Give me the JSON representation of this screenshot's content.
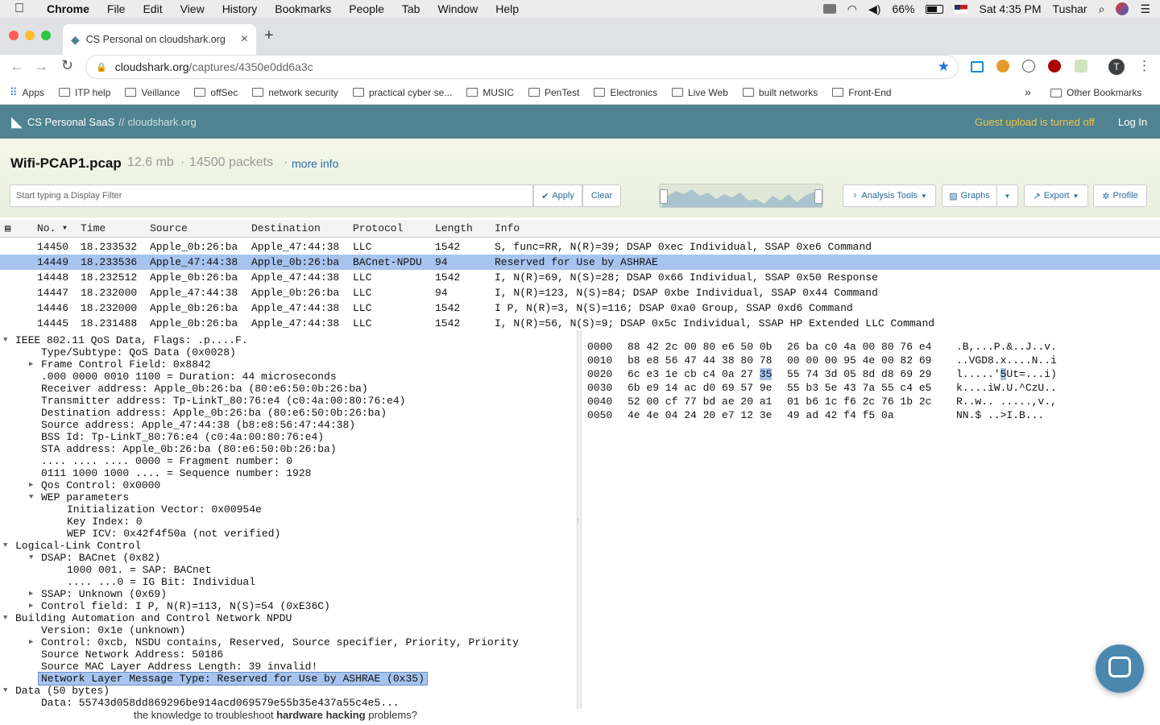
{
  "menubar": {
    "app": "Chrome",
    "items": [
      "File",
      "Edit",
      "View",
      "History",
      "Bookmarks",
      "People",
      "Tab",
      "Window",
      "Help"
    ],
    "battery": "66%",
    "clock": "Sat 4:35 PM",
    "user": "Tushar"
  },
  "tab": {
    "title": "CS Personal on cloudshark.org",
    "close": "×",
    "new": "+"
  },
  "omnibox": {
    "host": "cloudshark.org",
    "path": "/captures/4350e0dd6a3c"
  },
  "bookmarks": [
    "Apps",
    "ITP help",
    "Veillance",
    "offSec",
    "network security",
    "practical cyber se...",
    "MUSIC",
    "PenTest",
    "Electronics",
    "Live Web",
    "built networks",
    "Front-End"
  ],
  "bookmarks_more": "»",
  "bookmarks_other": "Other Bookmarks",
  "header": {
    "brand": "CS Personal SaaS",
    "sep": "//",
    "domain": "cloudshark.org",
    "notice": "Guest upload is turned off",
    "login": "Log In"
  },
  "file": {
    "name": "Wifi-PCAP1.pcap",
    "size": "12.6 mb",
    "dot": "·",
    "packets": "14500 packets",
    "more": "more info"
  },
  "filter": {
    "placeholder": "Start typing a Display Filter",
    "apply": "Apply",
    "clear": "Clear"
  },
  "tools": {
    "analysis": "Analysis Tools",
    "graphs": "Graphs",
    "export": "Export",
    "profile": "Profile"
  },
  "columns": [
    "No.",
    "Time",
    "Source",
    "Destination",
    "Protocol",
    "Length",
    "Info"
  ],
  "packets": [
    {
      "no": "14450",
      "time": "18.233532",
      "src": "Apple_0b:26:ba",
      "dst": "Apple_47:44:38",
      "proto": "LLC",
      "len": "1542",
      "info": "S, func=RR, N(R)=39; DSAP 0xec Individual, SSAP 0xe6 Command"
    },
    {
      "no": "14449",
      "time": "18.233536",
      "src": "Apple_47:44:38",
      "dst": "Apple_0b:26:ba",
      "proto": "BACnet-NPDU",
      "len": "94",
      "info": "Reserved for Use by ASHRAE"
    },
    {
      "no": "14448",
      "time": "18.232512",
      "src": "Apple_0b:26:ba",
      "dst": "Apple_47:44:38",
      "proto": "LLC",
      "len": "1542",
      "info": "I, N(R)=69, N(S)=28; DSAP 0x66 Individual, SSAP 0x50 Response"
    },
    {
      "no": "14447",
      "time": "18.232000",
      "src": "Apple_47:44:38",
      "dst": "Apple_0b:26:ba",
      "proto": "LLC",
      "len": "94",
      "info": "I, N(R)=123, N(S)=84; DSAP 0xbe Individual, SSAP 0x44 Command"
    },
    {
      "no": "14446",
      "time": "18.232000",
      "src": "Apple_0b:26:ba",
      "dst": "Apple_47:44:38",
      "proto": "LLC",
      "len": "1542",
      "info": "I P, N(R)=3, N(S)=116; DSAP 0xa0 Group, SSAP 0xd6 Command"
    },
    {
      "no": "14445",
      "time": "18.231488",
      "src": "Apple_0b:26:ba",
      "dst": "Apple_47:44:38",
      "proto": "LLC",
      "len": "1542",
      "info": "I, N(R)=56, N(S)=9; DSAP 0x5c Individual, SSAP HP Extended LLC Command"
    }
  ],
  "details": [
    {
      "t": "IEEE 802.11 QoS Data, Flags: .p....F.",
      "lvl": 0,
      "tw": "open"
    },
    {
      "t": "Type/Subtype: QoS Data (0x0028)",
      "lvl": 1,
      "tw": ""
    },
    {
      "t": "Frame Control Field: 0x8842",
      "lvl": 1,
      "tw": "closed"
    },
    {
      "t": ".000 0000 0010 1100 = Duration: 44 microseconds",
      "lvl": 1,
      "tw": ""
    },
    {
      "t": "Receiver address: Apple_0b:26:ba (80:e6:50:0b:26:ba)",
      "lvl": 1,
      "tw": ""
    },
    {
      "t": "Transmitter address: Tp-LinkT_80:76:e4 (c0:4a:00:80:76:e4)",
      "lvl": 1,
      "tw": ""
    },
    {
      "t": "Destination address: Apple_0b:26:ba (80:e6:50:0b:26:ba)",
      "lvl": 1,
      "tw": ""
    },
    {
      "t": "Source address: Apple_47:44:38 (b8:e8:56:47:44:38)",
      "lvl": 1,
      "tw": ""
    },
    {
      "t": "BSS Id: Tp-LinkT_80:76:e4 (c0:4a:00:80:76:e4)",
      "lvl": 1,
      "tw": ""
    },
    {
      "t": "STA address: Apple_0b:26:ba (80:e6:50:0b:26:ba)",
      "lvl": 1,
      "tw": ""
    },
    {
      "t": ".... .... .... 0000 = Fragment number: 0",
      "lvl": 1,
      "tw": ""
    },
    {
      "t": "0111 1000 1000 .... = Sequence number: 1928",
      "lvl": 1,
      "tw": ""
    },
    {
      "t": "Qos Control: 0x0000",
      "lvl": 1,
      "tw": "closed"
    },
    {
      "t": "WEP parameters",
      "lvl": 1,
      "tw": "open"
    },
    {
      "t": "Initialization Vector: 0x00954e",
      "lvl": 2,
      "tw": ""
    },
    {
      "t": "Key Index: 0",
      "lvl": 2,
      "tw": ""
    },
    {
      "t": "WEP ICV: 0x42f4f50a (not verified)",
      "lvl": 2,
      "tw": ""
    },
    {
      "t": "Logical-Link Control",
      "lvl": 0,
      "tw": "open"
    },
    {
      "t": "DSAP: BACnet (0x82)",
      "lvl": 1,
      "tw": "open"
    },
    {
      "t": "1000 001. = SAP: BACnet",
      "lvl": 2,
      "tw": ""
    },
    {
      "t": ".... ...0 = IG Bit: Individual",
      "lvl": 2,
      "tw": ""
    },
    {
      "t": "SSAP: Unknown (0x69)",
      "lvl": 1,
      "tw": "closed"
    },
    {
      "t": "Control field: I P, N(R)=113, N(S)=54 (0xE36C)",
      "lvl": 1,
      "tw": "closed"
    },
    {
      "t": "Building Automation and Control Network NPDU",
      "lvl": 0,
      "tw": "open"
    },
    {
      "t": "Version: 0x1e (unknown)",
      "lvl": 1,
      "tw": ""
    },
    {
      "t": "Control: 0xcb, NSDU contains, Reserved, Source specifier, Priority, Priority",
      "lvl": 1,
      "tw": "closed"
    },
    {
      "t": "Source Network Address: 50186",
      "lvl": 1,
      "tw": ""
    },
    {
      "t": "Source MAC Layer Address Length: 39 invalid!",
      "lvl": 1,
      "tw": ""
    },
    {
      "t": "Network Layer Message Type: Reserved for Use by ASHRAE (0x35)",
      "lvl": 1,
      "tw": "",
      "sel": true
    },
    {
      "t": "Data (50 bytes)",
      "lvl": 0,
      "tw": "open"
    },
    {
      "t": "Data: 55743d058dd869296be914acd069579e55b35e437a55c4e5...",
      "lvl": 1,
      "tw": ""
    }
  ],
  "hex": [
    {
      "off": "0000",
      "a": "88 42 2c 00 80 e6 50 0b",
      "b": "26 ba c0 4a 00 80 76 e4",
      "asc": ".B,...P.&..J..v."
    },
    {
      "off": "0010",
      "a": "b8 e8 56 47 44 38 80 78",
      "b": "00 00 00 95 4e 00 82 69",
      "asc": "..VGD8.x....N..i"
    },
    {
      "off": "0020",
      "a": "6c e3 1e cb c4 0a 27 35",
      "b": "55 74 3d 05 8d d8 69 29",
      "asc": "l.....'5Ut=...i)"
    },
    {
      "off": "0030",
      "a": "6b e9 14 ac d0 69 57 9e",
      "b": "55 b3 5e 43 7a 55 c4 e5",
      "asc": "k....iW.U.^CzU.."
    },
    {
      "off": "0040",
      "a": "52 00 cf 77 bd ae 20 a1",
      "b": "01 b6 1c f6 2c 76 1b 2c",
      "asc": "R..w.. .....,v.,"
    },
    {
      "off": "0050",
      "a": "4e 4e 04 24 20 e7 12 3e",
      "b": "49 ad 42 f4 f5 0a",
      "asc": "NN.$ ..>I.B..."
    }
  ],
  "bottom_text": {
    "a": "the knowledge to troubleshoot ",
    "b": "hardware hacking",
    "c": " problems?"
  }
}
